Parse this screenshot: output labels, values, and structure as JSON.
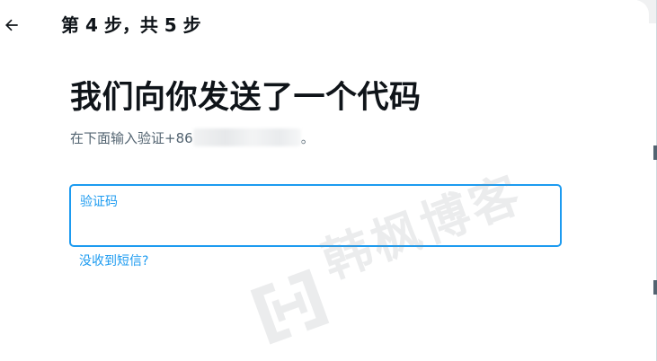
{
  "header": {
    "back_icon": "arrow-left-icon",
    "step_title": "第 4 步，共 5 步"
  },
  "main": {
    "title": "我们向你发送了一个代码",
    "subtitle_prefix": "在下面输入验证+86",
    "subtitle_suffix": "。"
  },
  "code_field": {
    "label": "验证码",
    "value": ""
  },
  "resend_link": "没收到短信?",
  "watermark": {
    "icon": "blog-logo-icon",
    "text": "韩枫博客"
  },
  "colors": {
    "accent": "#1d9bf0",
    "text_primary": "#0f1419",
    "text_secondary": "#536471",
    "background": "#ffffff"
  }
}
